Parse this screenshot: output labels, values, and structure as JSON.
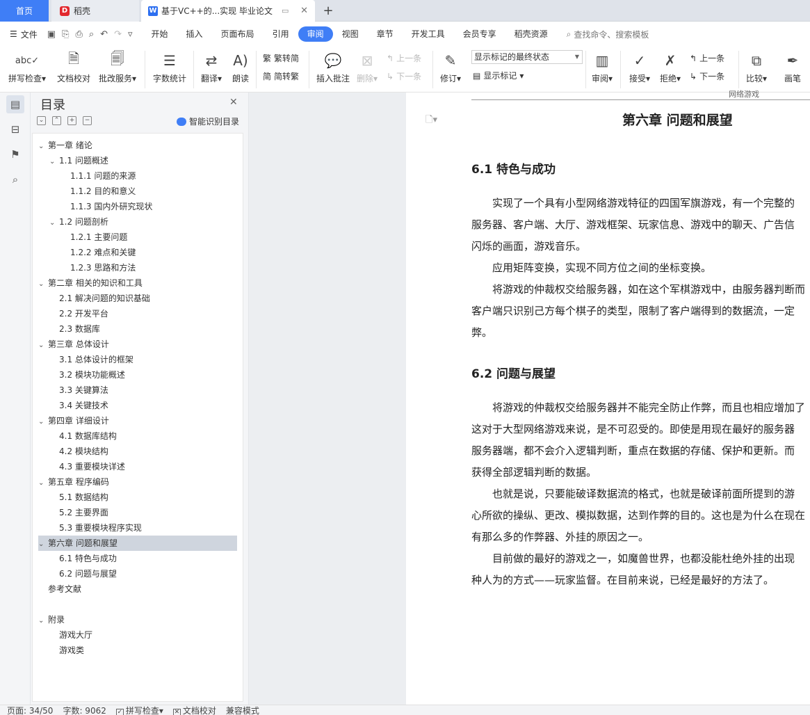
{
  "tabs": {
    "home": "首页",
    "daoke": "稻壳",
    "doc": "基于VC++的...实现 毕业论文"
  },
  "menubar": {
    "file": "文件",
    "items": [
      "开始",
      "插入",
      "页面布局",
      "引用",
      "审阅",
      "视图",
      "章节",
      "开发工具",
      "会员专享",
      "稻壳资源"
    ],
    "active_index": 4,
    "search": "查找命令、搜索模板"
  },
  "ribbon": {
    "spell": "拼写检查",
    "doccheck": "文档校对",
    "review_service": "批改服务",
    "wordcount": "字数统计",
    "translate": "翻译",
    "read": "朗读",
    "to_trad": "繁转简",
    "to_simp": "简转繁",
    "insert_comment": "插入批注",
    "delete": "删除",
    "prev_comment": "上一条",
    "next_comment": "下一条",
    "revise": "修订",
    "markup_mode": "显示标记的最终状态",
    "show_markup": "显示标记",
    "review": "审阅",
    "accept": "接受",
    "reject": "拒绝",
    "prev": "上一条",
    "next": "下一条",
    "compare": "比较",
    "pen": "画笔"
  },
  "toc": {
    "title": "目录",
    "smart": "智能识别目录",
    "items": [
      {
        "text": "第一章  绪论",
        "level": 1,
        "chev": "v"
      },
      {
        "text": "1.1  问题概述",
        "level": 2,
        "chev": "v"
      },
      {
        "text": "1.1.1  问题的来源",
        "level": 3,
        "chev": ""
      },
      {
        "text": "1.1.2  目的和意义",
        "level": 3,
        "chev": ""
      },
      {
        "text": "1.1.3  国内外研究现状",
        "level": 3,
        "chev": ""
      },
      {
        "text": "1.2  问题剖析",
        "level": 2,
        "chev": "v"
      },
      {
        "text": "1.2.1  主要问题",
        "level": 3,
        "chev": ""
      },
      {
        "text": "1.2.2  难点和关键",
        "level": 3,
        "chev": ""
      },
      {
        "text": "1.2.3  思路和方法",
        "level": 3,
        "chev": ""
      },
      {
        "text": "第二章  相关的知识和工具",
        "level": 1,
        "chev": "v"
      },
      {
        "text": "2.1  解决问题的知识基础",
        "level": 2,
        "chev": ""
      },
      {
        "text": "2.2  开发平台",
        "level": 2,
        "chev": ""
      },
      {
        "text": "2.3  数据库",
        "level": 2,
        "chev": ""
      },
      {
        "text": "第三章  总体设计",
        "level": 1,
        "chev": "v"
      },
      {
        "text": "3.1  总体设计的框架",
        "level": 2,
        "chev": ""
      },
      {
        "text": "3.2  模块功能概述",
        "level": 2,
        "chev": ""
      },
      {
        "text": "3.3  关键算法",
        "level": 2,
        "chev": ""
      },
      {
        "text": "3.4 关键技术",
        "level": 2,
        "chev": ""
      },
      {
        "text": "第四章  详细设计",
        "level": 1,
        "chev": "v"
      },
      {
        "text": "4.1 数据库结构",
        "level": 2,
        "chev": ""
      },
      {
        "text": "4.2 模块结构",
        "level": 2,
        "chev": ""
      },
      {
        "text": "4.3  重要模块详述",
        "level": 2,
        "chev": ""
      },
      {
        "text": "第五章  程序编码",
        "level": 1,
        "chev": "v"
      },
      {
        "text": "5.1  数据结构",
        "level": 2,
        "chev": ""
      },
      {
        "text": "5.2 主要界面",
        "level": 2,
        "chev": ""
      },
      {
        "text": "5.3  重要模块程序实现",
        "level": 2,
        "chev": ""
      },
      {
        "text": "第六章  问题和展望",
        "level": 1,
        "chev": "v",
        "selected": true
      },
      {
        "text": "6.1  特色与成功",
        "level": 2,
        "chev": ""
      },
      {
        "text": "6.2  问题与展望",
        "level": 2,
        "chev": ""
      },
      {
        "text": "参考文献",
        "level": 1,
        "chev": "",
        "gap_after": true
      },
      {
        "text": "附录",
        "level": 1,
        "chev": "v"
      },
      {
        "text": "游戏大厅",
        "level": 2,
        "chev": ""
      },
      {
        "text": "游戏类",
        "level": 2,
        "chev": ""
      }
    ]
  },
  "document": {
    "header": "网络游戏",
    "chapter": "第六章  问题和展望",
    "s1": "6.1  特色与成功",
    "s1_paras": [
      "　　实现了一个具有小型网络游戏特征的四国军旗游戏，有一个完整的",
      "服务器、客户端、大厅、游戏框架、玩家信息、游戏中的聊天、广告信",
      "闪烁的画面，游戏音乐。",
      "　　应用矩阵变换，实现不同方位之间的坐标变换。",
      "　　将游戏的仲裁权交给服务器，如在这个军棋游戏中，由服务器判断而",
      "客户端只识别己方每个棋子的类型，限制了客户端得到的数据流，一定",
      "弊。"
    ],
    "s2": "6.2  问题与展望",
    "s2_paras": [
      "　　将游戏的仲裁权交给服务器并不能完全防止作弊，而且也相应增加了",
      "这对于大型网络游戏来说，是不可忍受的。即使是用现在最好的服务器",
      "服务器端，都不会介入逻辑判断，重点在数据的存储、保护和更新。而",
      "获得全部逻辑判断的数据。",
      "　　也就是说，只要能破译数据流的格式，也就是破译前面所提到的游",
      "心所欲的操纵、更改、模拟数据，达到作弊的目的。这也是为什么在现在",
      "有那么多的作弊器、外挂的原因之一。",
      "　　目前做的最好的游戏之一，如魔兽世界，也都没能杜绝外挂的出现",
      "种人为的方式——玩家监督。在目前来说，已经是最好的方法了。"
    ]
  },
  "status": {
    "page": "页面: 34/50",
    "words": "字数: 9062",
    "spell": "拼写检查",
    "doccheck": "文档校对",
    "compat": "兼容模式"
  }
}
